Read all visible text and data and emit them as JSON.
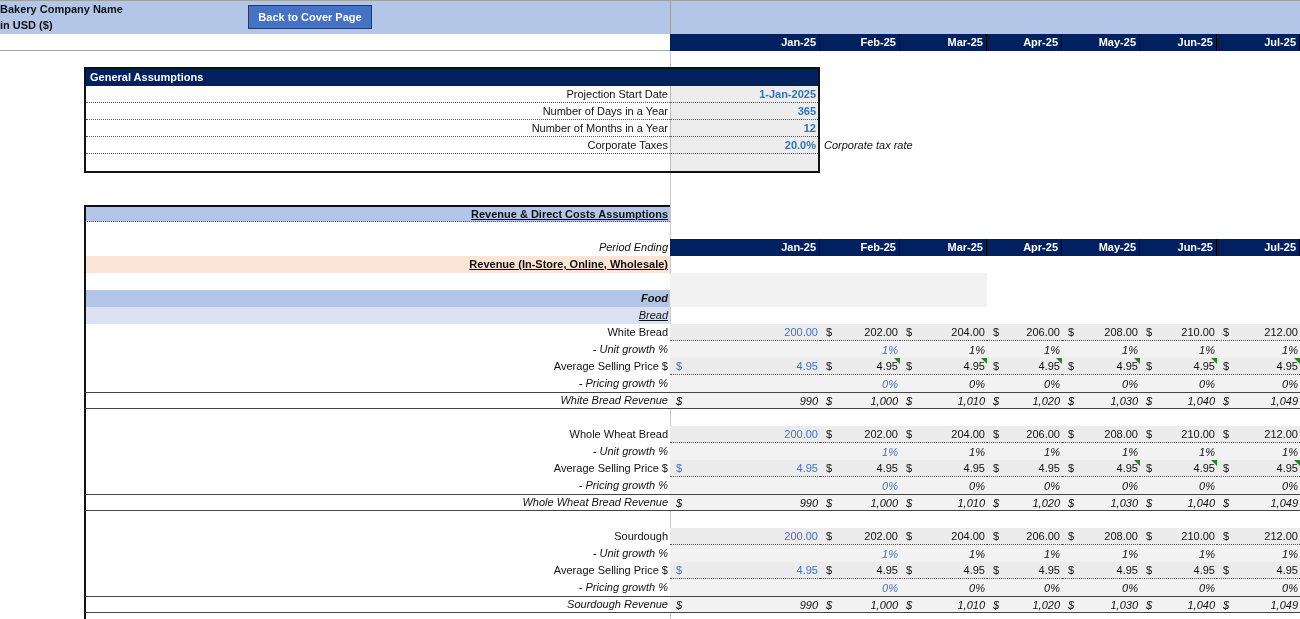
{
  "header": {
    "company": "Bakery Company Name",
    "currency": "in USD ($)",
    "back_button": "Back to Cover Page",
    "months": [
      "Jan-25",
      "Feb-25",
      "Mar-25",
      "Apr-25",
      "May-25",
      "Jun-25",
      "Jul-25"
    ]
  },
  "general_assumptions": {
    "title": "General Assumptions",
    "rows": [
      {
        "label": "Projection Start Date",
        "value": "1-Jan-2025"
      },
      {
        "label": "Number of Days in a Year",
        "value": "365"
      },
      {
        "label": "Number of Months in a Year",
        "value": "12"
      },
      {
        "label": "Corporate Taxes",
        "value": "20.0%",
        "note": "Corporate tax rate"
      }
    ]
  },
  "revenue": {
    "title": "Revenue & Direct Costs Assumptions",
    "period_label": "Period Ending",
    "months": [
      "Jan-25",
      "Feb-25",
      "Mar-25",
      "Apr-25",
      "May-25",
      "Jun-25",
      "Jul-25"
    ],
    "heading": "Revenue (In-Store, Online, Wholesale)",
    "category": "Food",
    "subcategory": "Bread",
    "products": [
      {
        "rows": [
          {
            "kind": "units",
            "label": "White Bread",
            "cells": [
              {
                "value": "200.00",
                "input": true
              },
              {
                "prefix": "$",
                "value": "202.00",
                "input": false
              },
              {
                "prefix": "$",
                "value": "204.00",
                "input": false
              },
              {
                "prefix": "$",
                "value": "206.00",
                "input": false
              },
              {
                "prefix": "$",
                "value": "208.00",
                "input": false
              },
              {
                "prefix": "$",
                "value": "210.00",
                "input": false
              },
              {
                "prefix": "$",
                "value": "212.00",
                "input": false
              }
            ]
          },
          {
            "kind": "growth",
            "label": "- Unit growth %",
            "cells": [
              {
                "value": "1%",
                "input": true
              },
              {
                "value": "1%",
                "input": false
              },
              {
                "value": "1%",
                "input": false
              },
              {
                "value": "1%",
                "input": false
              },
              {
                "value": "1%",
                "input": false
              },
              {
                "value": "1%",
                "input": false
              }
            ]
          },
          {
            "kind": "price",
            "label": "Average Selling Price $",
            "cells": [
              {
                "prefix": "$",
                "value": "4.95",
                "input": true,
                "flag": false
              },
              {
                "prefix": "$",
                "value": "4.95",
                "input": false,
                "flag": true
              },
              {
                "prefix": "$",
                "value": "4.95",
                "input": false,
                "flag": true
              },
              {
                "prefix": "$",
                "value": "4.95",
                "input": false,
                "flag": true
              },
              {
                "prefix": "$",
                "value": "4.95",
                "input": false,
                "flag": true
              },
              {
                "prefix": "$",
                "value": "4.95",
                "input": false,
                "flag": true
              },
              {
                "prefix": "$",
                "value": "4.95",
                "input": false,
                "flag": true
              }
            ]
          },
          {
            "kind": "growth",
            "label": "- Pricing growth %",
            "cells": [
              {
                "value": "0%",
                "input": true
              },
              {
                "value": "0%",
                "input": false
              },
              {
                "value": "0%",
                "input": false
              },
              {
                "value": "0%",
                "input": false
              },
              {
                "value": "0%",
                "input": false
              },
              {
                "value": "0%",
                "input": false
              }
            ]
          },
          {
            "kind": "revenue",
            "label": "White Bread Revenue",
            "cells": [
              {
                "prefix": "$",
                "value": "990",
                "input": false
              },
              {
                "prefix": "$",
                "value": "1,000",
                "input": false
              },
              {
                "prefix": "$",
                "value": "1,010",
                "input": false
              },
              {
                "prefix": "$",
                "value": "1,020",
                "input": false
              },
              {
                "prefix": "$",
                "value": "1,030",
                "input": false
              },
              {
                "prefix": "$",
                "value": "1,040",
                "input": false
              },
              {
                "prefix": "$",
                "value": "1,049",
                "input": false
              }
            ]
          }
        ]
      },
      {
        "rows": [
          {
            "kind": "units",
            "label": "Whole Wheat Bread",
            "cells": [
              {
                "value": "200.00",
                "input": true
              },
              {
                "prefix": "$",
                "value": "202.00",
                "input": false
              },
              {
                "prefix": "$",
                "value": "204.00",
                "input": false
              },
              {
                "prefix": "$",
                "value": "206.00",
                "input": false
              },
              {
                "prefix": "$",
                "value": "208.00",
                "input": false
              },
              {
                "prefix": "$",
                "value": "210.00",
                "input": false
              },
              {
                "prefix": "$",
                "value": "212.00",
                "input": false
              }
            ]
          },
          {
            "kind": "growth",
            "label": "- Unit growth %",
            "cells": [
              {
                "value": "1%",
                "input": true
              },
              {
                "value": "1%",
                "input": false
              },
              {
                "value": "1%",
                "input": false
              },
              {
                "value": "1%",
                "input": false
              },
              {
                "value": "1%",
                "input": false
              },
              {
                "value": "1%",
                "input": false
              }
            ]
          },
          {
            "kind": "price",
            "label": "Average Selling Price $",
            "cells": [
              {
                "prefix": "$",
                "value": "4.95",
                "input": true,
                "flag": false
              },
              {
                "prefix": "$",
                "value": "4.95",
                "input": false,
                "flag": false
              },
              {
                "prefix": "$",
                "value": "4.95",
                "input": false,
                "flag": false
              },
              {
                "prefix": "$",
                "value": "4.95",
                "input": false,
                "flag": false
              },
              {
                "prefix": "$",
                "value": "4.95",
                "input": false,
                "flag": true
              },
              {
                "prefix": "$",
                "value": "4.95",
                "input": false,
                "flag": true
              },
              {
                "prefix": "$",
                "value": "4.95",
                "input": false,
                "flag": true
              }
            ]
          },
          {
            "kind": "growth",
            "label": "- Pricing growth %",
            "cells": [
              {
                "value": "0%",
                "input": true
              },
              {
                "value": "0%",
                "input": false
              },
              {
                "value": "0%",
                "input": false
              },
              {
                "value": "0%",
                "input": false
              },
              {
                "value": "0%",
                "input": false
              },
              {
                "value": "0%",
                "input": false
              }
            ]
          },
          {
            "kind": "revenue",
            "label": "Whole Wheat Bread Revenue",
            "cells": [
              {
                "prefix": "$",
                "value": "990",
                "input": false
              },
              {
                "prefix": "$",
                "value": "1,000",
                "input": false
              },
              {
                "prefix": "$",
                "value": "1,010",
                "input": false
              },
              {
                "prefix": "$",
                "value": "1,020",
                "input": false
              },
              {
                "prefix": "$",
                "value": "1,030",
                "input": false
              },
              {
                "prefix": "$",
                "value": "1,040",
                "input": false
              },
              {
                "prefix": "$",
                "value": "1,049",
                "input": false
              }
            ]
          }
        ]
      },
      {
        "rows": [
          {
            "kind": "units",
            "label": "Sourdough",
            "cells": [
              {
                "value": "200.00",
                "input": true
              },
              {
                "prefix": "$",
                "value": "202.00",
                "input": false
              },
              {
                "prefix": "$",
                "value": "204.00",
                "input": false
              },
              {
                "prefix": "$",
                "value": "206.00",
                "input": false
              },
              {
                "prefix": "$",
                "value": "208.00",
                "input": false
              },
              {
                "prefix": "$",
                "value": "210.00",
                "input": false
              },
              {
                "prefix": "$",
                "value": "212.00",
                "input": false
              }
            ]
          },
          {
            "kind": "growth",
            "label": "- Unit growth %",
            "cells": [
              {
                "value": "1%",
                "input": true
              },
              {
                "value": "1%",
                "input": false
              },
              {
                "value": "1%",
                "input": false
              },
              {
                "value": "1%",
                "input": false
              },
              {
                "value": "1%",
                "input": false
              },
              {
                "value": "1%",
                "input": false
              }
            ]
          },
          {
            "kind": "price",
            "label": "Average Selling Price $",
            "cells": [
              {
                "prefix": "$",
                "value": "4.95",
                "input": true,
                "flag": false
              },
              {
                "prefix": "$",
                "value": "4.95",
                "input": false,
                "flag": false
              },
              {
                "prefix": "$",
                "value": "4.95",
                "input": false,
                "flag": false
              },
              {
                "prefix": "$",
                "value": "4.95",
                "input": false,
                "flag": false
              },
              {
                "prefix": "$",
                "value": "4.95",
                "input": false,
                "flag": false
              },
              {
                "prefix": "$",
                "value": "4.95",
                "input": false,
                "flag": false
              },
              {
                "prefix": "$",
                "value": "4.95",
                "input": false,
                "flag": false
              }
            ]
          },
          {
            "kind": "growth",
            "label": "- Pricing growth %",
            "cells": [
              {
                "value": "0%",
                "input": true
              },
              {
                "value": "0%",
                "input": false
              },
              {
                "value": "0%",
                "input": false
              },
              {
                "value": "0%",
                "input": false
              },
              {
                "value": "0%",
                "input": false
              },
              {
                "value": "0%",
                "input": false
              }
            ]
          },
          {
            "kind": "revenue",
            "label": "Sourdough Revenue",
            "cells": [
              {
                "prefix": "$",
                "value": "990",
                "input": false
              },
              {
                "prefix": "$",
                "value": "1,000",
                "input": false
              },
              {
                "prefix": "$",
                "value": "1,010",
                "input": false
              },
              {
                "prefix": "$",
                "value": "1,020",
                "input": false
              },
              {
                "prefix": "$",
                "value": "1,030",
                "input": false
              },
              {
                "prefix": "$",
                "value": "1,040",
                "input": false
              },
              {
                "prefix": "$",
                "value": "1,049",
                "input": false
              }
            ]
          }
        ]
      }
    ]
  }
}
